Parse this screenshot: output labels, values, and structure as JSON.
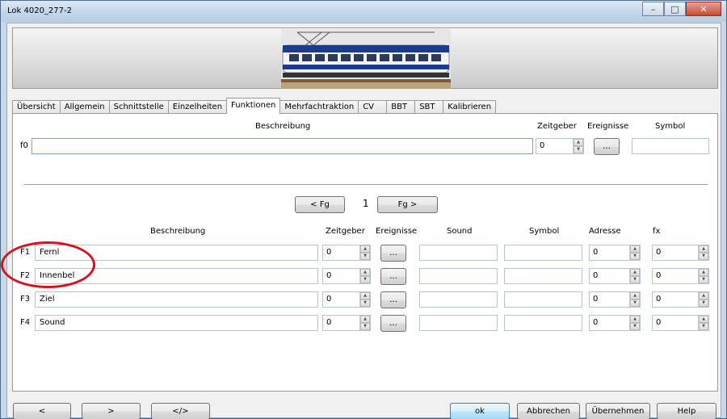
{
  "window": {
    "title": "Lok 4020_277-2",
    "min": "–",
    "max": "□",
    "close": "✕"
  },
  "tabs": [
    "Übersicht",
    "Allgemein",
    "Schnittstelle",
    "Einzelheiten",
    "Funktionen",
    "Mehrfachtraktion",
    "CV",
    "BBT",
    "SBT",
    "Kalibrieren"
  ],
  "active_tab": "Funktionen",
  "f0": {
    "label": "f0",
    "headers": {
      "beschreibung": "Beschreibung",
      "zeitgeber": "Zeitgeber",
      "ereignisse": "Ereignisse",
      "symbol": "Symbol"
    },
    "beschreibung": "",
    "zeitgeber": "0",
    "ereignisse_btn": "...",
    "symbol": ""
  },
  "paging": {
    "prev": "< Fg",
    "page": "1",
    "next": "Fg >"
  },
  "headers": {
    "beschreibung": "Beschreibung",
    "zeitgeber": "Zeitgeber",
    "ereignisse": "Ereignisse",
    "sound": "Sound",
    "symbol": "Symbol",
    "adresse": "Adresse",
    "fx": "fx"
  },
  "rows": [
    {
      "label": "F1",
      "beschreibung": "Fernl",
      "zeitgeber": "0",
      "ereignisse": "...",
      "sound": "",
      "symbol": "",
      "adresse": "0",
      "fx": "0"
    },
    {
      "label": "F2",
      "beschreibung": "Innenbel",
      "zeitgeber": "0",
      "ereignisse": "...",
      "sound": "",
      "symbol": "",
      "adresse": "0",
      "fx": "0"
    },
    {
      "label": "F3",
      "beschreibung": "Ziel",
      "zeitgeber": "0",
      "ereignisse": "...",
      "sound": "",
      "symbol": "",
      "adresse": "0",
      "fx": "0"
    },
    {
      "label": "F4",
      "beschreibung": "Sound",
      "zeitgeber": "0",
      "ereignisse": "...",
      "sound": "",
      "symbol": "",
      "adresse": "0",
      "fx": "0"
    }
  ],
  "bottom": {
    "back": "<",
    "forward": ">",
    "code": "</>",
    "ok": "ok",
    "abbrechen": "Abbrechen",
    "uebernehmen": "Übernehmen",
    "help": "Help"
  },
  "colors": {
    "annotation": "#d8121b",
    "ok_button": "#bee6fd",
    "titlebar": "#c6d7ea"
  }
}
